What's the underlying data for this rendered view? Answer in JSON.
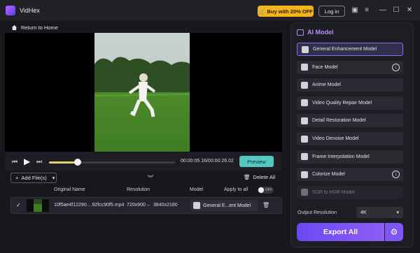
{
  "app": {
    "name": "VidHex"
  },
  "titlebar": {
    "buy_label": "Buy with 20% OFF",
    "login_label": "Log in"
  },
  "nav": {
    "home_label": "Return to Home"
  },
  "player": {
    "time": "00:00:05.16/00:00:26.02",
    "progress": 0.23,
    "preview_label": "Preview"
  },
  "list": {
    "add_label": "Add File(s)",
    "delete_all_label": "Delete All",
    "headers": {
      "original_name": "Original Name",
      "resolution": "Resolution",
      "model": "Model",
      "apply_all": "Apply to all"
    },
    "toggle_state": "OFF",
    "rows": [
      {
        "name": "10f5ae4f12290....92fcc90f5.mp4",
        "res_from": "720x900",
        "arrow": "→",
        "res_to": "3840x2160",
        "model": "General E...ent Model"
      }
    ]
  },
  "panel": {
    "title": "AI Model",
    "models": [
      {
        "label": "General Enhancement Model",
        "state": "selected"
      },
      {
        "label": "Face Model",
        "state": "download"
      },
      {
        "label": "Anime Model",
        "state": "normal"
      },
      {
        "label": "Video Quality Repair Model",
        "state": "normal"
      },
      {
        "label": "Detail Restoration Model",
        "state": "normal"
      },
      {
        "label": "Video Denoise Model",
        "state": "normal"
      },
      {
        "label": "Frame Interpolation Model",
        "state": "normal"
      },
      {
        "label": "Colorize Model",
        "state": "download"
      },
      {
        "label": "SDR to HDR Model",
        "state": "disabled"
      }
    ],
    "output_resolution_label": "Output Resolution",
    "output_resolution_value": "4K",
    "export_label": "Export All"
  },
  "colors": {
    "accent": "#7b57f4",
    "preview": "#53c7c2",
    "buy": "#f3b41c"
  }
}
